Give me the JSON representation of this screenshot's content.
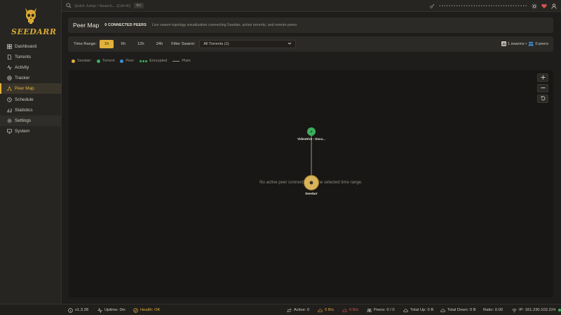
{
  "app": {
    "name": "SEEDARR"
  },
  "sidebar": {
    "items": [
      {
        "label": "Dashboard",
        "icon": "grid-icon"
      },
      {
        "label": "Torrents",
        "icon": "file-icon"
      },
      {
        "label": "Activity",
        "icon": "activity-icon"
      },
      {
        "label": "Tracker",
        "icon": "radar-icon"
      },
      {
        "label": "Peer Map",
        "icon": "network-icon"
      },
      {
        "label": "Schedule",
        "icon": "clock-icon"
      },
      {
        "label": "Statistics",
        "icon": "chart-icon"
      },
      {
        "label": "Settings",
        "icon": "gear-icon"
      },
      {
        "label": "System",
        "icon": "monitor-icon"
      }
    ],
    "active": "Peer Map"
  },
  "topbar": {
    "search_placeholder": "Quick Jump / Search... (Ctrl+K)",
    "shortcut": "⌘K",
    "masked_token": "••••••••••••••••••••••••••••••••••••"
  },
  "header": {
    "title": "Peer Map",
    "badge": "0 CONNECTED PEERS",
    "description": "Live swarm topology visualization connecting Seedarr, active torrents, and remote peers"
  },
  "filters": {
    "time_range_label": "Time Range:",
    "time_options": [
      "1h",
      "6h",
      "12h",
      "24h"
    ],
    "time_selected": "1h",
    "swarm_label": "Filter Swarm:",
    "swarm_selected": "All Torrents (1)",
    "swarms_stat": "1 swarms •",
    "peers_stat": "0 peers"
  },
  "legend": {
    "seedarr": "Seedarr",
    "torrent": "Torrent",
    "peer": "Peer",
    "encrypted": "Encrypted",
    "plain": "Plain"
  },
  "map": {
    "empty_message": "No active peer connections in the selected time range.",
    "torrent_node_label": "VideoHive - Docu...",
    "seedarr_node_label": "Seedarr",
    "zoom_in": "+",
    "zoom_out": "−",
    "reset": "⟲"
  },
  "colors": {
    "accent": "#e2b13c",
    "torrent": "#3cae5c",
    "peer": "#3c8fd6",
    "background": "#1e1d1b",
    "upload": "#e2a23c",
    "download": "#d9534f",
    "health": "#e2b13c",
    "online": "#3cae5c"
  },
  "status": {
    "version": "v1.3.28",
    "uptime": "Uptime: 0m",
    "health": "Health: OK",
    "active": "Active: 0",
    "upload_speed": "0 B/s",
    "download_speed": "0 B/s",
    "peers": "Peers: 0 / 0",
    "total_up": "Total Up: 0 B",
    "total_down": "Total Down: 0 B",
    "ratio": "Ratio: 0.00",
    "ip": "IP: 161.230.102.224"
  }
}
